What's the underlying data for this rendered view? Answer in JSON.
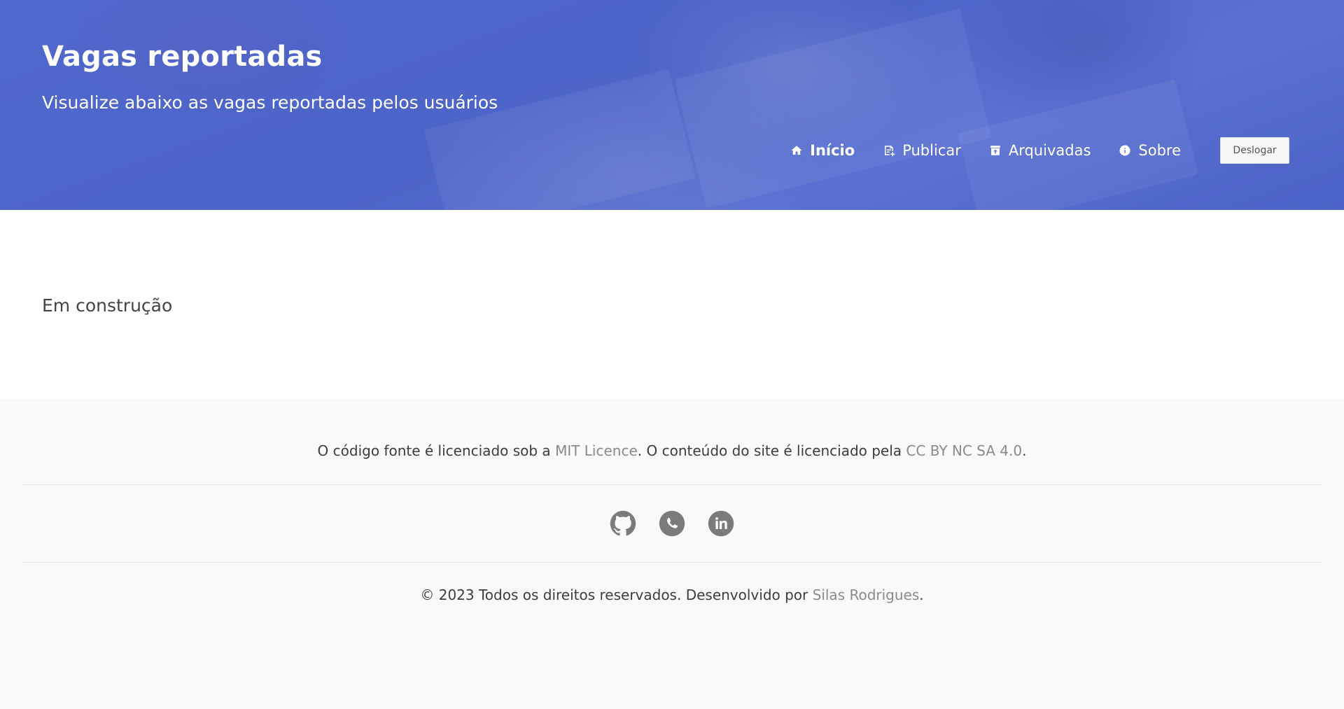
{
  "header": {
    "title": "Vagas reportadas",
    "subtitle": "Visualize abaixo as vagas reportadas pelos usuários",
    "accent_color": "#4e65c9"
  },
  "nav": {
    "items": [
      {
        "label": "Início",
        "icon": "home-icon",
        "active": true
      },
      {
        "label": "Publicar",
        "icon": "post-add-icon",
        "active": false
      },
      {
        "label": "Arquivadas",
        "icon": "archive-icon",
        "active": false
      },
      {
        "label": "Sobre",
        "icon": "info-icon",
        "active": false
      }
    ],
    "logout_label": "Deslogar"
  },
  "main": {
    "status_text": "Em construção"
  },
  "footer": {
    "license_prefix": "O código fonte é licenciado sob a ",
    "license_code_link": "MIT Licence",
    "license_middle": ". O conteúdo do site é licenciado pela ",
    "license_content_link": "CC BY NC SA 4.0",
    "license_suffix": ".",
    "social": [
      {
        "name": "github-icon"
      },
      {
        "name": "whatsapp-icon"
      },
      {
        "name": "linkedin-icon"
      }
    ],
    "copyright_prefix": "© 2023 Todos os direitos reservados. Desenvolvido por ",
    "author_link": "Silas Rodrigues",
    "copyright_suffix": "."
  }
}
